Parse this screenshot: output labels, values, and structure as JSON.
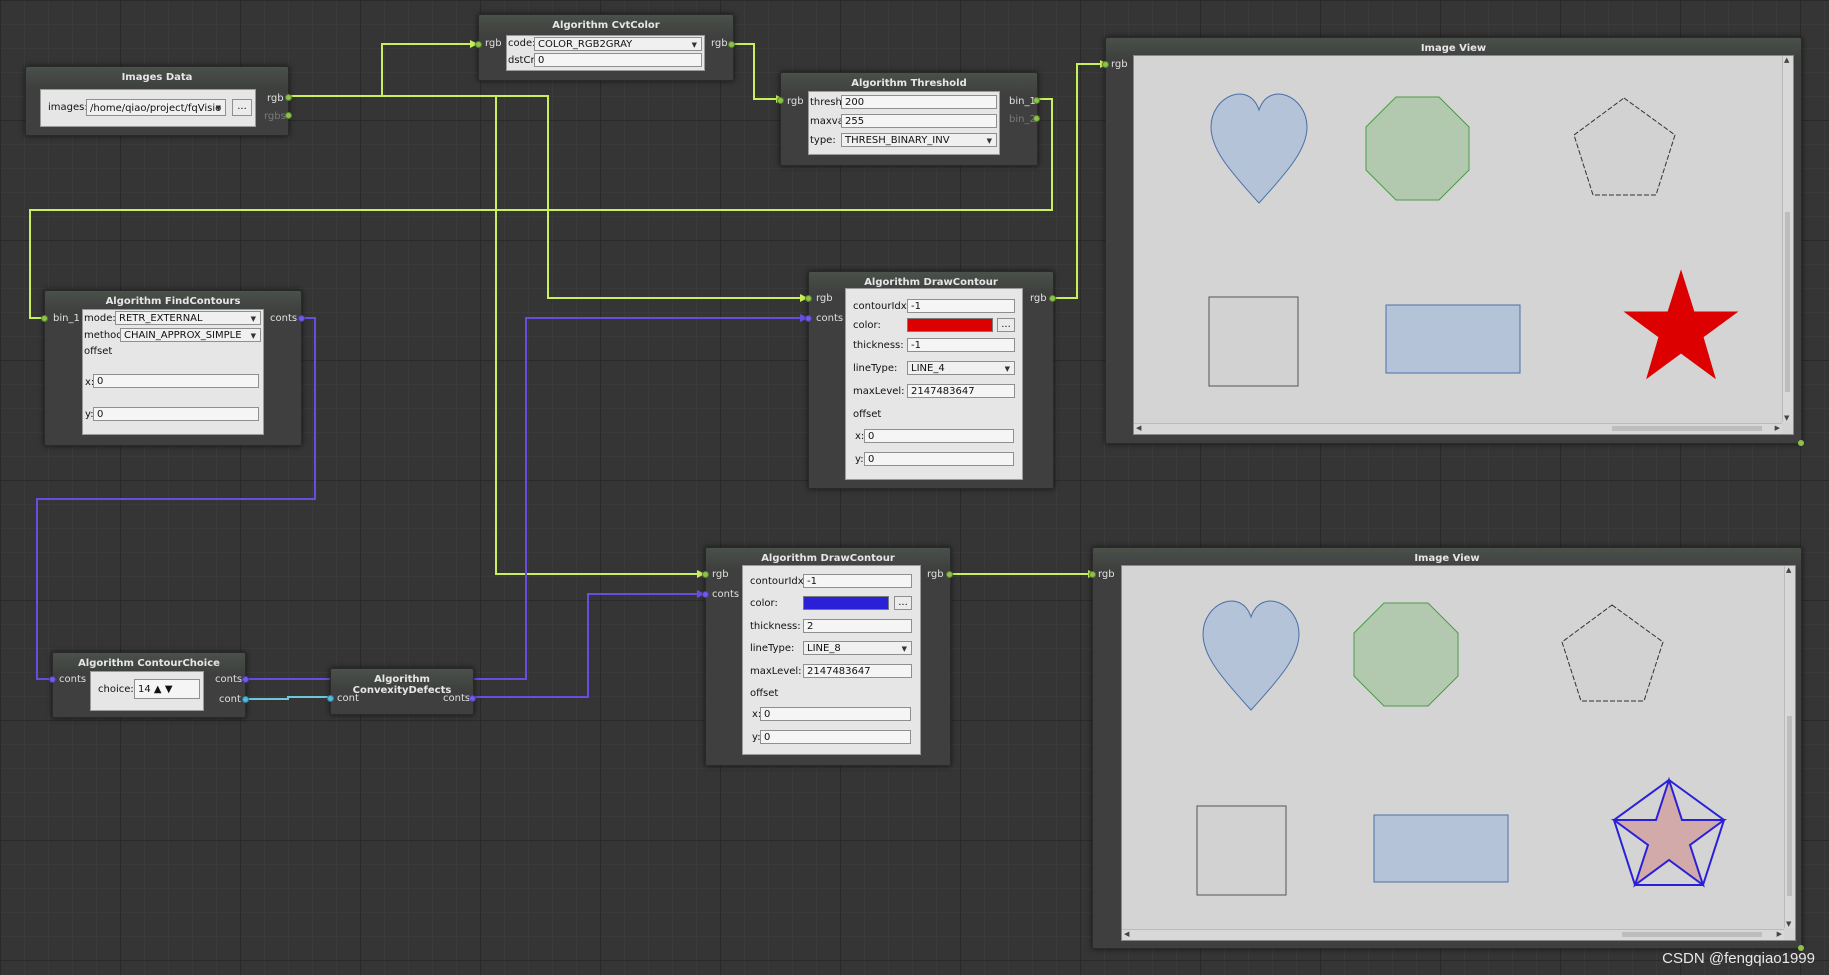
{
  "colors": {
    "wire_image": "#c8f05a",
    "wire_contours": "#6a4de0",
    "wire_contour": "#6fc6d8",
    "draw_color_1": "#dd0000",
    "draw_color_2": "#2a20d8"
  },
  "images_data": {
    "title": "Images Data",
    "images_label": "images:",
    "images_value": "/home/qiao/project/fqVisio",
    "browse_label": "...",
    "out_rgb": "rgb",
    "out_rgbs": "rgbs"
  },
  "cvtcolor": {
    "title": "Algorithm CvtColor",
    "in_rgb": "rgb",
    "out_rgb": "rgb",
    "code_label": "code:",
    "code_value": "COLOR_RGB2GRAY",
    "dstcn_label": "dstCn:",
    "dstcn_value": "0"
  },
  "threshold": {
    "title": "Algorithm Threshold",
    "in_rgb": "rgb",
    "out_bin1": "bin_1",
    "out_bin2": "bin_2",
    "thresh_label": "thresh:",
    "thresh_value": "200",
    "maxval_label": "maxval:",
    "maxval_value": "255",
    "type_label": "type:",
    "type_value": "THRESH_BINARY_INV"
  },
  "findcontours": {
    "title": "Algorithm FindContours",
    "in_bin1": "bin_1",
    "out_conts": "conts",
    "mode_label": "mode:",
    "mode_value": "RETR_EXTERNAL",
    "method_label": "method:",
    "method_value": "CHAIN_APPROX_SIMPLE",
    "offset_label": "offset",
    "x_label": "x:",
    "x_value": "0",
    "y_label": "y:",
    "y_value": "0"
  },
  "drawcontour1": {
    "title": "Algorithm DrawContour",
    "in_rgb": "rgb",
    "in_conts": "conts",
    "out_rgb": "rgb",
    "idx_label": "contourIdx:",
    "idx_value": "-1",
    "color_label": "color:",
    "color_btn": "...",
    "thickness_label": "thickness:",
    "thickness_value": "-1",
    "linetype_label": "lineType:",
    "linetype_value": "LINE_4",
    "maxlevel_label": "maxLevel:",
    "maxlevel_value": "2147483647",
    "offset_label": "offset",
    "x_label": "x:",
    "x_value": "0",
    "y_label": "y:",
    "y_value": "0"
  },
  "drawcontour2": {
    "title": "Algorithm DrawContour",
    "in_rgb": "rgb",
    "in_conts": "conts",
    "out_rgb": "rgb",
    "idx_label": "contourIdx:",
    "idx_value": "-1",
    "color_label": "color:",
    "color_btn": "...",
    "thickness_label": "thickness:",
    "thickness_value": "2",
    "linetype_label": "lineType:",
    "linetype_value": "LINE_8",
    "maxlevel_label": "maxLevel:",
    "maxlevel_value": "2147483647",
    "offset_label": "offset",
    "x_label": "x:",
    "x_value": "0",
    "y_label": "y:",
    "y_value": "0"
  },
  "contourchoice": {
    "title": "Algorithm ContourChoice",
    "in_conts": "conts",
    "out_conts": "conts",
    "out_cont": "cont",
    "choice_label": "choice:",
    "choice_value": "14"
  },
  "convexity": {
    "title": "Algorithm ConvexityDefects",
    "in_cont": "cont",
    "out_conts": "conts"
  },
  "imageview1": {
    "title": "Image View",
    "in_rgb": "rgb"
  },
  "imageview2": {
    "title": "Image View",
    "in_rgb": "rgb"
  },
  "watermark": "CSDN @fengqiao1999"
}
